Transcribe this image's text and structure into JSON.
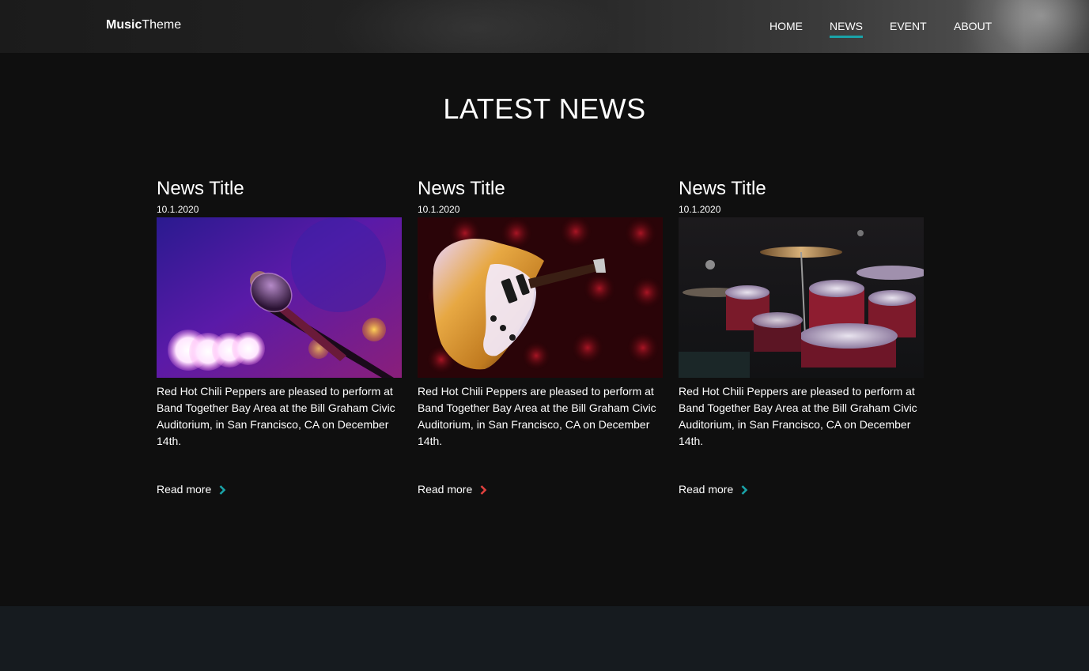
{
  "header": {
    "logo_bold": "Music",
    "logo_light": "Theme",
    "nav": [
      {
        "label": "HOME",
        "active": false
      },
      {
        "label": "NEWS",
        "active": true
      },
      {
        "label": "EVENT",
        "active": false
      },
      {
        "label": "ABOUT",
        "active": false
      }
    ],
    "accent_color": "#1aa3a8"
  },
  "main": {
    "title": "LATEST NEWS",
    "cards": [
      {
        "title": "News Title",
        "date": "10.1.2020",
        "image": "microphone-image",
        "text": "Red Hot Chili Peppers are pleased to perform at Band Together Bay Area at the Bill Graham Civic Auditorium, in San Francisco, CA on December 14th.",
        "read_more": "Read more",
        "chevron_color": "#1aa3a8"
      },
      {
        "title": "News Title",
        "date": "10.1.2020",
        "image": "guitar-image",
        "text": "Red Hot Chili Peppers are pleased to perform at Band Together Bay Area at the Bill Graham Civic Auditorium, in San Francisco, CA on December 14th.",
        "read_more": "Read more",
        "chevron_color": "#e0413e"
      },
      {
        "title": "News Title",
        "date": "10.1.2020",
        "image": "drums-image",
        "text": "Red Hot Chili Peppers are pleased to perform at Band Together Bay Area at the Bill Graham Civic Auditorium, in San Francisco, CA on December 14th.",
        "read_more": "Read more",
        "chevron_color": "#1aa3a8"
      }
    ]
  }
}
